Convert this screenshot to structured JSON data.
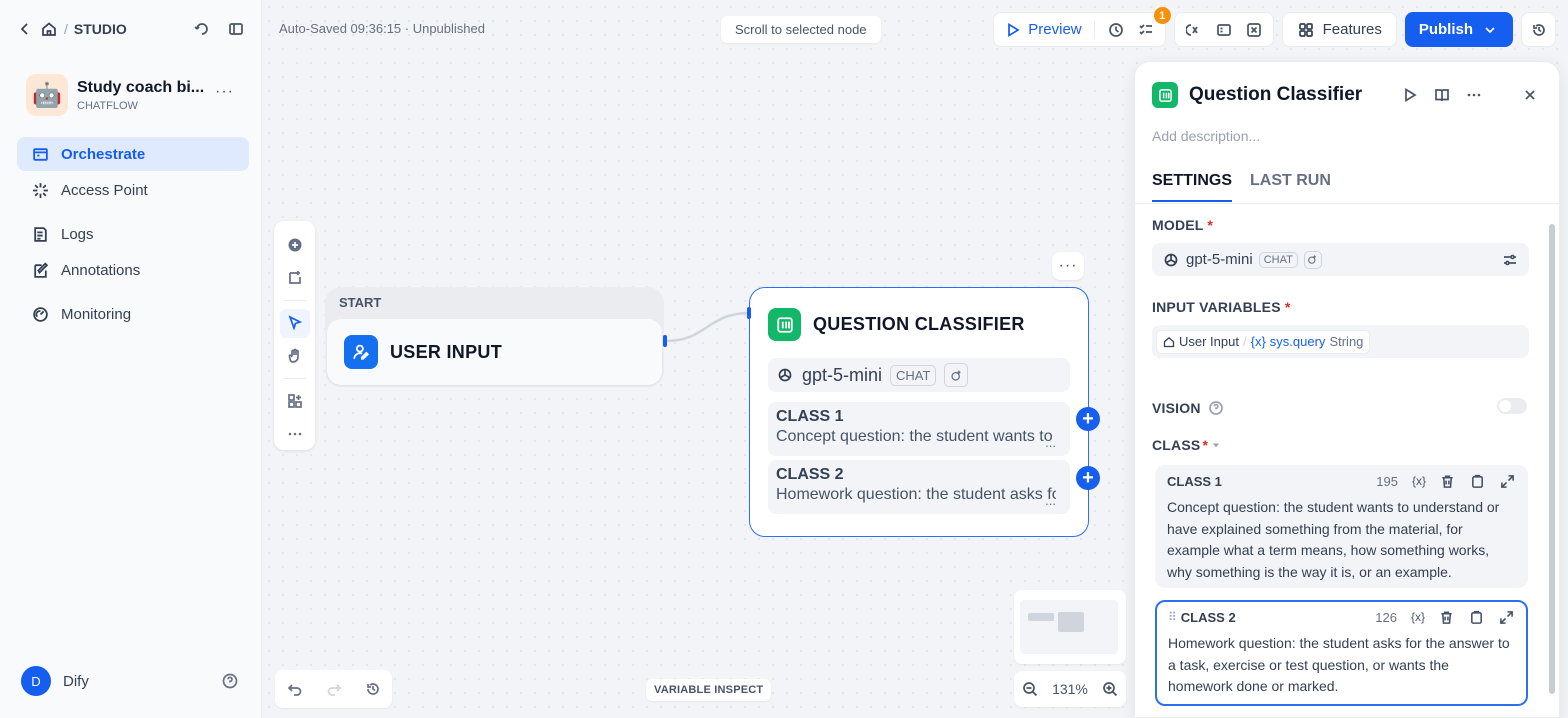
{
  "sidebar": {
    "breadcrumb": "STUDIO",
    "app": {
      "name": "Study coach bi...",
      "type": "CHATFLOW",
      "avatar": "🤖"
    },
    "nav": [
      {
        "label": "Orchestrate",
        "icon": "orchestrate-icon",
        "active": true
      },
      {
        "label": "Access Point",
        "icon": "access-point-icon"
      },
      {
        "label": "Logs",
        "icon": "logs-icon"
      },
      {
        "label": "Annotations",
        "icon": "annotations-icon"
      },
      {
        "label": "Monitoring",
        "icon": "monitoring-icon"
      }
    ],
    "user": {
      "initial": "D",
      "name": "Dify"
    }
  },
  "canvas": {
    "autosave": "Auto-Saved 09:36:15 · Unpublished",
    "scroll_button": "Scroll to selected node",
    "variable_inspect": "VARIABLE INSPECT",
    "zoom": "131%"
  },
  "toolbar": {
    "preview": "Preview",
    "checklist_badge": "1",
    "features": "Features",
    "publish": "Publish"
  },
  "nodes": {
    "start": {
      "label": "START",
      "title": "USER INPUT"
    },
    "classifier": {
      "title": "QUESTION CLASSIFIER",
      "model": "gpt-5-mini",
      "model_mode": "CHAT",
      "classes": [
        {
          "title": "CLASS 1",
          "preview": "Concept question: the student wants to understand"
        },
        {
          "title": "CLASS 2",
          "preview": "Homework question: the student asks for the answer"
        }
      ],
      "ellipsis": "..."
    }
  },
  "panel": {
    "title": "Question Classifier",
    "description_placeholder": "Add description...",
    "tabs": {
      "settings": "SETTINGS",
      "last_run": "LAST RUN"
    },
    "model_label": "MODEL",
    "model": "gpt-5-mini",
    "model_mode": "CHAT",
    "input_variables_label": "INPUT VARIABLES",
    "input_variable": {
      "node": "User Input",
      "slash": "/",
      "name": "sys.query",
      "type": "String"
    },
    "vision_label": "VISION",
    "class_label": "CLASS",
    "required_mark": "*",
    "classes": [
      {
        "title": "CLASS 1",
        "count": "195",
        "text": "Concept question: the student wants to understand or have explained something from the material, for example what a term means, how something works, why something is the way it is, or an example."
      },
      {
        "title": "CLASS 2",
        "count": "126",
        "text": "Homework question: the student asks for the answer to a task, exercise or test question, or wants the homework done or marked."
      }
    ]
  }
}
